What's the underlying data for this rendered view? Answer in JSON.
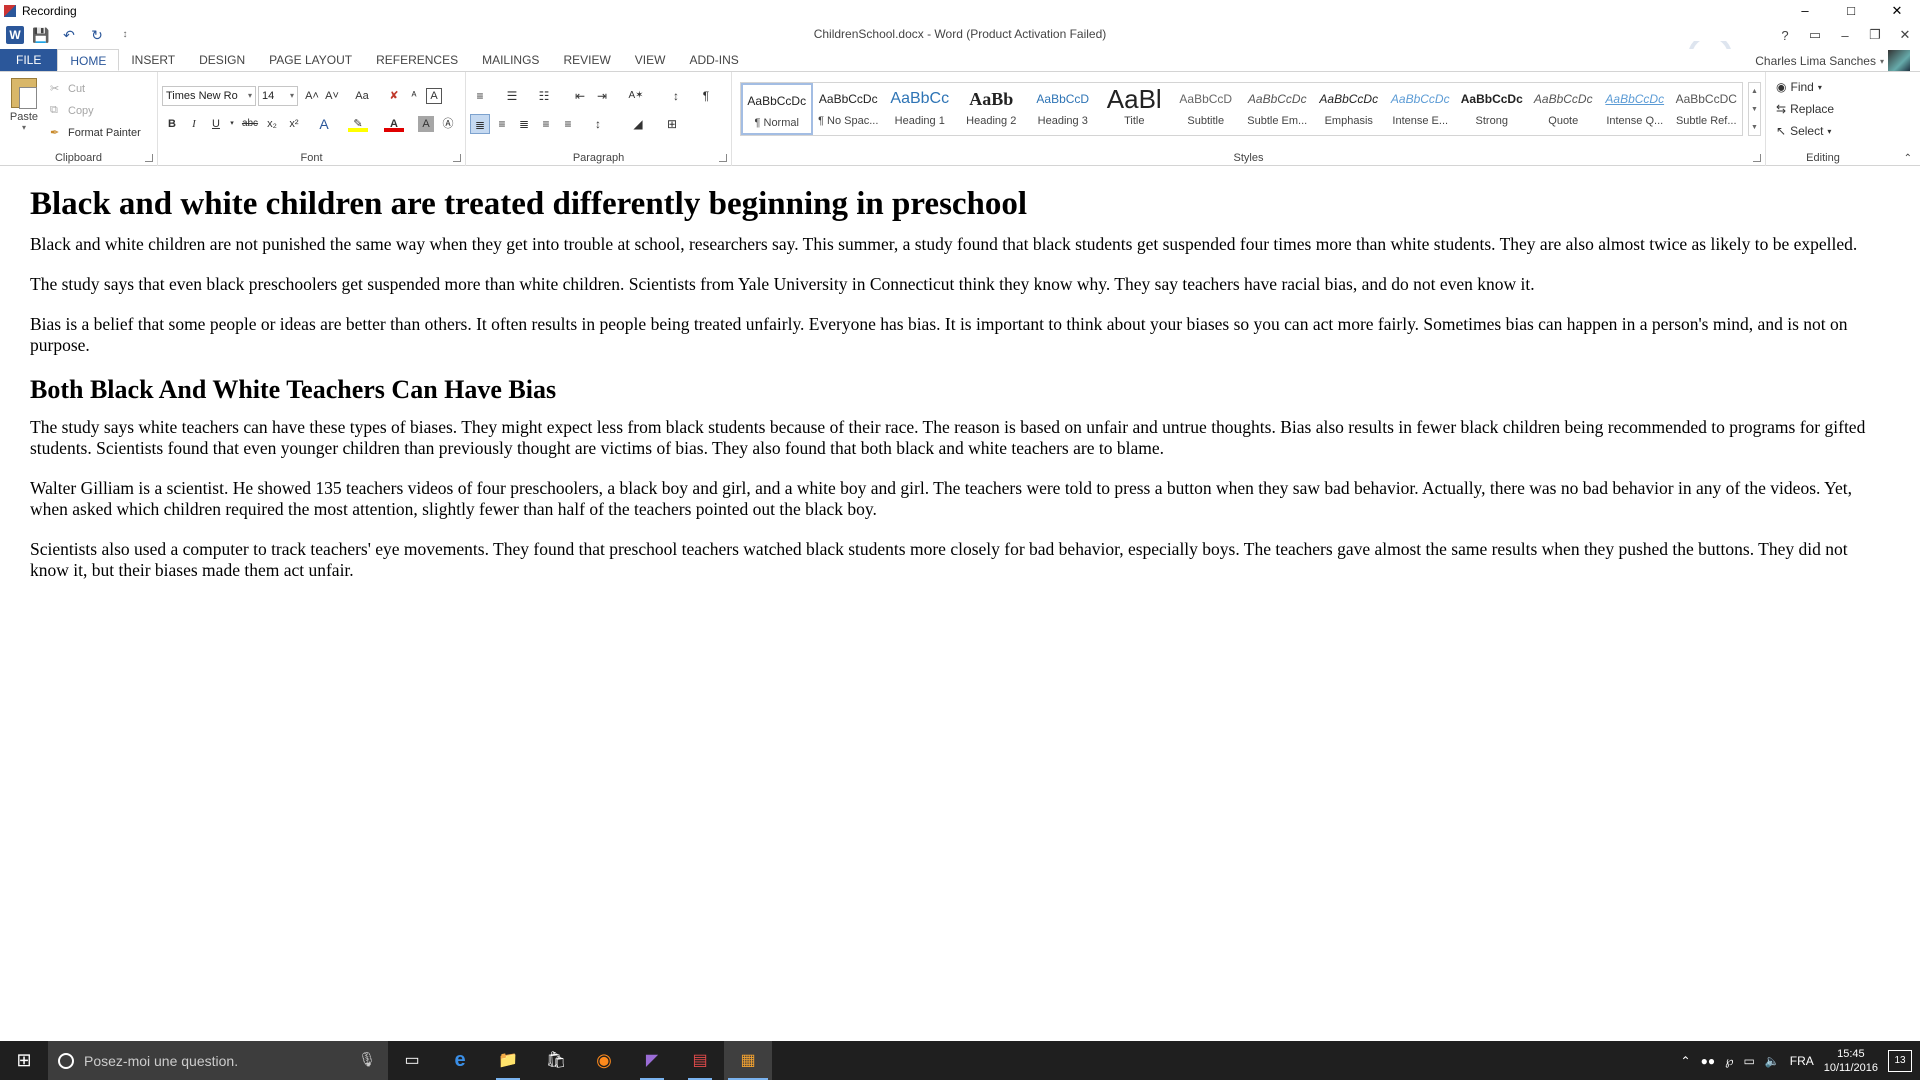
{
  "recording": {
    "title": "Recording",
    "minimize": "–",
    "maximize": "□",
    "close": "✕"
  },
  "titlebar": {
    "doc_title": "ChildrenSchool.docx - Word (Product Activation Failed)",
    "help": "?",
    "ribbon_display": "▭",
    "minimize": "–",
    "restore": "❐",
    "close": "✕",
    "qat_word": "W",
    "qat_save": "💾",
    "qat_undo": "↶",
    "qat_redo": "↻",
    "qat_customize": "↕"
  },
  "tabs": [
    "FILE",
    "HOME",
    "INSERT",
    "DESIGN",
    "PAGE LAYOUT",
    "REFERENCES",
    "MAILINGS",
    "REVIEW",
    "VIEW",
    "ADD-INS"
  ],
  "user": {
    "name": "Charles Lima Sanches"
  },
  "clipboard": {
    "label": "Clipboard",
    "paste": "Paste",
    "cut": "Cut",
    "copy": "Copy",
    "format_painter": "Format Painter"
  },
  "font": {
    "label": "Font",
    "name": "Times New Ro",
    "size": "14",
    "grow": "A˄",
    "shrink": "A˅",
    "case": "Aa",
    "clear": "✘",
    "bold": "B",
    "italic": "I",
    "underline": "U",
    "strike": "abc",
    "sub": "x₂",
    "sup": "x²",
    "effects": "A",
    "highlight": "✎",
    "color": "A",
    "shading": "A",
    "enclose": "Ⓐ",
    "phonetic": "ᴬ"
  },
  "paragraph": {
    "label": "Paragraph",
    "bullets": "≡",
    "numbering": "☰",
    "multilevel": "☷",
    "dec_indent": "⇤",
    "inc_indent": "⇥",
    "asian": "A✶",
    "sort": "↕",
    "pilcrow": "¶",
    "align_left": "≣",
    "center": "≡",
    "align_right": "≣",
    "justify": "≡",
    "distributed": "≡",
    "spacing": "↕",
    "fill": "◢",
    "borders": "⊞"
  },
  "styles": {
    "label": "Styles",
    "items": [
      {
        "preview": "AaBbCcDc",
        "name": "¶ Normal"
      },
      {
        "preview": "AaBbCcDc",
        "name": "¶ No Spac..."
      },
      {
        "preview": "AaBbCc",
        "name": "Heading 1"
      },
      {
        "preview": "AaBb",
        "name": "Heading 2"
      },
      {
        "preview": "AaBbCcD",
        "name": "Heading 3"
      },
      {
        "preview": "AaBl",
        "name": "Title"
      },
      {
        "preview": "AaBbCcD",
        "name": "Subtitle"
      },
      {
        "preview": "AaBbCcDc",
        "name": "Subtle Em..."
      },
      {
        "preview": "AaBbCcDc",
        "name": "Emphasis"
      },
      {
        "preview": "AaBbCcDc",
        "name": "Intense E..."
      },
      {
        "preview": "AaBbCcDc",
        "name": "Strong"
      },
      {
        "preview": "AaBbCcDc",
        "name": "Quote"
      },
      {
        "preview": "AaBbCcDc",
        "name": "Intense Q..."
      },
      {
        "preview": "AaBbCcDC",
        "name": "Subtle Ref..."
      }
    ]
  },
  "editing": {
    "label": "Editing",
    "find": "Find",
    "replace": "Replace",
    "select": "Select"
  },
  "document": {
    "h1": "Black and white children are treated differently beginning in preschool",
    "p1": "Black and white children are not punished the same way when they get into trouble at school, researchers say. This summer, a study found that black students get suspended four times more than white students. They are also almost twice as likely to be expelled.",
    "p2": "The study says that even black preschoolers get suspended more than white children. Scientists from Yale University in Connecticut think they know why. They say teachers have racial bias, and do not even know it.",
    "p3": "Bias is a belief that some people or ideas are better than others. It often results in people being treated unfairly. Everyone has bias. It is important to think about your biases so you can act more fairly. Sometimes bias can happen in a person's mind, and is not on purpose.",
    "h2": "Both Black And White Teachers Can Have Bias",
    "p4": "The study says white teachers can have these types of biases. They might expect less from black students because of their race. The reason is based on unfair and untrue thoughts. Bias also results in fewer black children being recommended to programs for gifted students. Scientists found that even younger children than previously thought are victims of bias. They also found that both black and white teachers are to blame.",
    "p5": "Walter Gilliam is a scientist. He showed 135 teachers videos of four preschoolers, a black boy and girl, and a white boy and girl. The teachers were told to press a button when they saw bad behavior. Actually, there was no bad behavior in any of the videos. Yet, when asked which children required the most attention, slightly fewer than half of the teachers pointed out the black boy.",
    "p6": "Scientists also used a computer to track teachers' eye movements. They found that preschool teachers watched black students more closely for bad behavior, especially boys. The teachers gave almost the same results when they pushed the buttons. They did not know it, but their biases made them act unfair."
  },
  "taskbar": {
    "search_placeholder": "Posez-moi une question.",
    "apps": [
      "task-view",
      "edge",
      "file-explorer",
      "store",
      "firefox",
      "visual-studio",
      "acrobat",
      "recorder"
    ],
    "app_glyphs": [
      "▭",
      "e",
      "📁",
      "🛍",
      "◉",
      "◤",
      "▤",
      "▦"
    ],
    "language": "FRA",
    "time": "15:45",
    "date": "10/11/2016",
    "notifications": "13"
  },
  "colors": {
    "accent": "#2b579a",
    "taskbar": "#1f1f1f"
  }
}
